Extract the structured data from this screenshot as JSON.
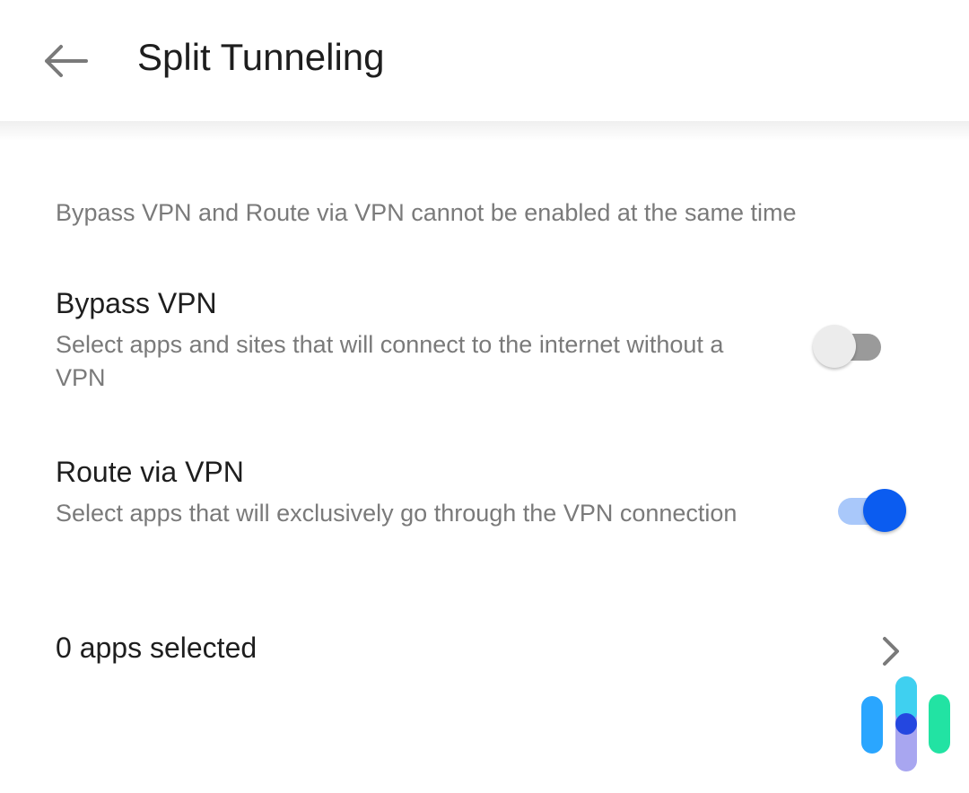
{
  "header": {
    "title": "Split Tunneling",
    "back_icon": "arrow-left-icon"
  },
  "notice": "Bypass VPN and Route via VPN cannot be enabled at the same time",
  "settings": [
    {
      "title": "Bypass VPN",
      "description": "Select apps and sites that will connect to the internet without a VPN",
      "enabled": false
    },
    {
      "title": "Route via VPN",
      "description": "Select apps that will exclusively go through the VPN connection",
      "enabled": true
    }
  ],
  "apps_selected": {
    "label": "0 apps selected",
    "icon": "chevron-right-icon"
  },
  "colors": {
    "accent": "#0b5cf0",
    "accent_track": "#a9c8fa",
    "off_track": "#9a9a9a",
    "off_knob": "#ececec"
  },
  "watermark": {
    "icon": "brand-logo"
  }
}
